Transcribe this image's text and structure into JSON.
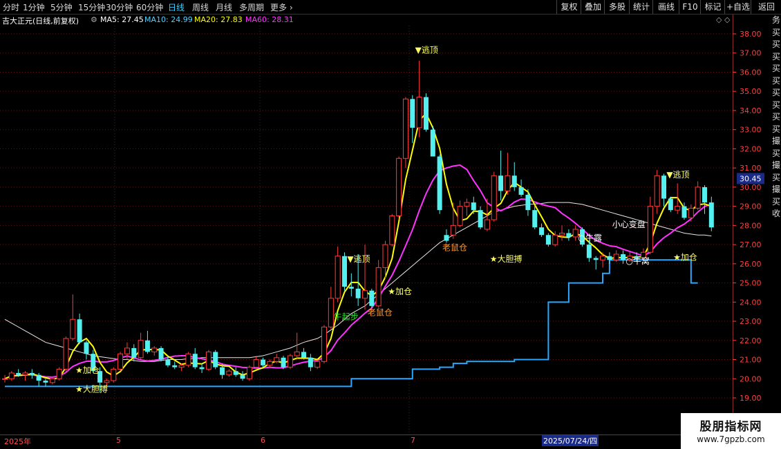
{
  "toolbar": {
    "periods": [
      "分时",
      "1分钟",
      "5分钟",
      "15分钟",
      "30分钟",
      "60分钟",
      "日线",
      "周线",
      "月线",
      "多周期",
      "更多"
    ],
    "active": "日线",
    "right_buttons": [
      "复权",
      "叠加",
      "多股",
      "统计",
      "画线",
      "F10",
      "标记",
      "+自选",
      "返回"
    ]
  },
  "infobar": {
    "stock": "吉大正元(日线,前复权)",
    "ma5": "MA5: 27.45",
    "ma10": "MA10: 24.99",
    "ma20": "MA20: 27.83",
    "ma60": "MA60: 28.31",
    "diamonds": "◇ ◇"
  },
  "colors": {
    "up": "#ff3a3a",
    "down": "#54f0f0",
    "ma5": "#ffff00",
    "ma20": "#ff33ff",
    "ma60": "#e8e8e8",
    "stop": "#29a8ff",
    "axis": "#ff4040",
    "grid": "#5a1a1a"
  },
  "current_price_label": "30.45",
  "bottom_axis": {
    "labels": [
      "2025年",
      "5",
      "6",
      "7"
    ],
    "cursor_date": "2025/07/24/四"
  },
  "watermark": {
    "title": "股朋指标网",
    "url": "www.7gpzb.com"
  },
  "side_strip_text": "务买买买买买买买买买撮买撮买撮买收",
  "chart_data": {
    "type": "candlestick",
    "y_ticks": [
      19.0,
      20.0,
      21.0,
      22.0,
      23.0,
      24.0,
      25.0,
      26.0,
      27.0,
      28.0,
      29.0,
      30.0,
      31.0,
      32.0,
      33.0,
      34.0,
      35.0,
      36.0,
      37.0,
      38.0
    ],
    "ylim": [
      18.4,
      38.6
    ],
    "candles": [
      [
        20.0,
        20.2,
        19.8,
        20.0
      ],
      [
        20.0,
        20.4,
        19.9,
        20.3
      ],
      [
        20.3,
        20.5,
        20.1,
        20.2
      ],
      [
        20.2,
        20.4,
        19.9,
        20.3
      ],
      [
        20.3,
        20.5,
        20.0,
        20.2
      ],
      [
        20.2,
        20.3,
        19.6,
        19.9
      ],
      [
        19.9,
        20.0,
        19.6,
        19.8
      ],
      [
        19.8,
        20.1,
        19.7,
        20.0
      ],
      [
        20.0,
        20.6,
        19.9,
        20.5
      ],
      [
        20.5,
        22.2,
        20.3,
        22.1
      ],
      [
        22.1,
        24.4,
        22.0,
        23.1
      ],
      [
        23.1,
        23.4,
        21.8,
        21.9
      ],
      [
        21.9,
        22.0,
        21.0,
        21.3
      ],
      [
        21.3,
        21.5,
        20.3,
        20.4
      ],
      [
        20.4,
        20.6,
        19.3,
        19.8
      ],
      [
        19.8,
        20.0,
        19.6,
        19.9
      ],
      [
        19.9,
        20.6,
        19.8,
        20.5
      ],
      [
        20.5,
        21.4,
        20.4,
        21.3
      ],
      [
        21.3,
        21.9,
        21.0,
        21.6
      ],
      [
        21.6,
        21.8,
        20.9,
        21.1
      ],
      [
        21.1,
        22.4,
        21.0,
        22.0
      ],
      [
        22.0,
        22.5,
        21.3,
        21.4
      ],
      [
        21.4,
        21.7,
        21.2,
        21.6
      ],
      [
        21.6,
        21.7,
        20.9,
        21.0
      ],
      [
        21.0,
        21.2,
        20.6,
        20.7
      ],
      [
        20.7,
        20.9,
        20.5,
        20.6
      ],
      [
        20.6,
        20.8,
        20.4,
        20.7
      ],
      [
        20.7,
        21.4,
        20.6,
        21.3
      ],
      [
        21.3,
        21.6,
        20.5,
        20.6
      ],
      [
        20.6,
        20.8,
        20.3,
        20.5
      ],
      [
        20.5,
        21.5,
        20.4,
        21.4
      ],
      [
        21.4,
        21.5,
        20.5,
        20.6
      ],
      [
        20.6,
        20.8,
        20.0,
        20.2
      ],
      [
        20.2,
        20.5,
        20.1,
        20.4
      ],
      [
        20.4,
        20.6,
        20.1,
        20.2
      ],
      [
        20.2,
        20.4,
        19.9,
        20.0
      ],
      [
        20.0,
        20.7,
        19.9,
        20.6
      ],
      [
        20.6,
        21.2,
        20.5,
        21.0
      ],
      [
        21.0,
        21.1,
        20.6,
        20.7
      ],
      [
        20.7,
        21.0,
        20.6,
        20.9
      ],
      [
        20.9,
        21.3,
        20.8,
        21.1
      ],
      [
        21.1,
        21.2,
        20.5,
        20.6
      ],
      [
        20.6,
        21.3,
        20.5,
        21.2
      ],
      [
        21.2,
        22.4,
        21.0,
        21.4
      ],
      [
        21.4,
        21.6,
        21.0,
        21.1
      ],
      [
        21.1,
        21.3,
        20.4,
        20.6
      ],
      [
        20.6,
        21.0,
        20.5,
        20.9
      ],
      [
        20.9,
        22.8,
        20.8,
        22.7
      ],
      [
        22.7,
        24.8,
        22.6,
        24.2
      ],
      [
        24.2,
        26.9,
        24.0,
        26.4
      ],
      [
        26.4,
        26.6,
        24.6,
        24.8
      ],
      [
        24.8,
        25.5,
        24.3,
        24.7
      ],
      [
        24.7,
        26.5,
        23.8,
        24.2
      ],
      [
        24.2,
        27.0,
        23.6,
        24.6
      ],
      [
        24.6,
        24.7,
        23.7,
        23.8
      ],
      [
        23.8,
        26.2,
        23.7,
        25.8
      ],
      [
        25.8,
        27.2,
        25.2,
        27.0
      ],
      [
        27.0,
        28.6,
        26.9,
        28.5
      ],
      [
        28.5,
        31.6,
        28.3,
        31.5
      ],
      [
        31.5,
        34.7,
        31.0,
        34.6
      ],
      [
        34.6,
        34.8,
        32.3,
        33.1
      ],
      [
        33.1,
        36.6,
        32.6,
        34.7
      ],
      [
        34.7,
        34.9,
        32.9,
        33.0
      ],
      [
        33.0,
        33.2,
        31.8,
        31.6
      ],
      [
        31.6,
        31.7,
        28.6,
        28.8
      ],
      [
        27.5,
        27.8,
        27.1,
        27.2
      ],
      [
        27.5,
        29.2,
        27.3,
        28.0
      ],
      [
        28.0,
        29.3,
        27.9,
        29.0
      ],
      [
        29.0,
        29.4,
        28.5,
        29.2
      ],
      [
        29.2,
        29.5,
        28.6,
        28.8
      ],
      [
        28.8,
        29.0,
        27.8,
        27.9
      ],
      [
        27.8,
        29.4,
        27.7,
        28.3
      ],
      [
        28.3,
        30.8,
        28.2,
        30.6
      ],
      [
        30.6,
        31.9,
        29.3,
        29.8
      ],
      [
        29.8,
        31.8,
        29.6,
        30.6
      ],
      [
        30.6,
        31.3,
        29.8,
        30.0
      ],
      [
        30.0,
        30.4,
        29.5,
        29.6
      ],
      [
        29.6,
        29.9,
        28.5,
        28.8
      ],
      [
        28.8,
        29.0,
        27.8,
        27.9
      ],
      [
        27.9,
        28.1,
        27.4,
        27.5
      ],
      [
        27.5,
        27.6,
        26.9,
        27.0
      ],
      [
        27.0,
        27.7,
        26.9,
        27.5
      ],
      [
        27.5,
        28.0,
        27.2,
        27.6
      ],
      [
        27.6,
        27.8,
        27.2,
        27.4
      ],
      [
        27.4,
        28.0,
        27.2,
        27.8
      ],
      [
        27.8,
        27.9,
        26.9,
        27.0
      ],
      [
        27.0,
        27.2,
        26.1,
        26.3
      ],
      [
        26.3,
        26.4,
        25.7,
        26.2
      ],
      [
        26.2,
        26.6,
        25.8,
        26.4
      ],
      [
        26.4,
        26.6,
        26.0,
        26.2
      ],
      [
        26.2,
        26.7,
        26.1,
        26.5
      ],
      [
        26.5,
        26.7,
        26.0,
        26.2
      ],
      [
        26.2,
        26.6,
        26.1,
        26.4
      ],
      [
        26.4,
        26.6,
        26.1,
        26.3
      ],
      [
        26.3,
        26.8,
        26.2,
        26.6
      ],
      [
        26.6,
        29.5,
        26.5,
        29.0
      ],
      [
        29.0,
        30.9,
        28.6,
        30.6
      ],
      [
        30.6,
        30.7,
        29.0,
        29.4
      ],
      [
        29.4,
        29.5,
        28.7,
        28.8
      ],
      [
        28.8,
        30.2,
        28.6,
        29.0
      ],
      [
        29.0,
        29.2,
        28.3,
        28.4
      ],
      [
        28.4,
        29.1,
        28.2,
        28.9
      ],
      [
        28.9,
        30.3,
        28.8,
        30.0
      ],
      [
        30.0,
        30.1,
        28.6,
        29.2
      ],
      [
        29.2,
        29.5,
        27.7,
        27.9
      ]
    ],
    "ma60_values": [
      23.1,
      22.9,
      22.7,
      22.5,
      22.3,
      22.1,
      21.9,
      21.8,
      21.7,
      21.6,
      21.5,
      21.4,
      21.3,
      21.2,
      21.15,
      21.1,
      21.05,
      21.0,
      21.0,
      20.95,
      20.9,
      20.9,
      20.9,
      20.95,
      21.0,
      21.0,
      21.0,
      21.05,
      21.05,
      21.1,
      21.1,
      21.1,
      21.1,
      21.1,
      21.1,
      21.1,
      21.1,
      21.15,
      21.2,
      21.3,
      21.4,
      21.5,
      21.6,
      21.75,
      21.9,
      22.0,
      22.1,
      22.3,
      22.55,
      22.8,
      23.1,
      23.4,
      23.6,
      23.8,
      24.1,
      24.4,
      24.7,
      25.0,
      25.3,
      25.6,
      25.9,
      26.2,
      26.5,
      26.8,
      27.1,
      27.3,
      27.5,
      27.7,
      27.9,
      28.1,
      28.3,
      28.5,
      28.7,
      28.8,
      28.9,
      29.0,
      29.05,
      29.1,
      29.12,
      29.15,
      29.2,
      29.2,
      29.2,
      29.2,
      29.15,
      29.1,
      29.0,
      28.9,
      28.8,
      28.7,
      28.6,
      28.5,
      28.4,
      28.3,
      28.2,
      28.1,
      28.0,
      27.9,
      27.8,
      27.7,
      27.6,
      27.55,
      27.5,
      27.5,
      27.45
    ],
    "stop_line": [
      [
        0,
        19.6
      ],
      [
        47,
        19.6
      ],
      [
        51,
        20.0
      ],
      [
        56,
        20.0
      ],
      [
        60,
        20.5
      ],
      [
        63,
        20.5
      ],
      [
        64,
        20.6
      ],
      [
        66,
        20.8
      ],
      [
        68,
        20.9
      ],
      [
        73,
        20.9
      ],
      [
        75,
        21.0
      ],
      [
        77,
        21.0
      ],
      [
        80,
        21.0
      ],
      [
        80,
        24.0
      ],
      [
        83,
        25.0
      ],
      [
        87,
        25.0
      ],
      [
        88,
        25.5
      ],
      [
        89,
        26.2
      ],
      [
        101,
        26.2
      ],
      [
        101,
        25.0
      ],
      [
        102,
        25.0
      ]
    ],
    "stop_line_style": "step",
    "annotations": [
      {
        "text": "▼逃顶",
        "x": 61,
        "y": 37.0,
        "color": "#ffff66"
      },
      {
        "text": "▼逃顶",
        "x": 51,
        "y": 26.1,
        "color": "#ffff66"
      },
      {
        "text": "▼逃顶",
        "x": 98,
        "y": 30.5,
        "color": "#ffff66"
      },
      {
        "text": "★加仓",
        "x": 11,
        "y": 20.3,
        "color": "#ffff66"
      },
      {
        "text": "★加仓",
        "x": 57,
        "y": 24.4,
        "color": "#ffff66"
      },
      {
        "text": "★加仓",
        "x": 99,
        "y": 26.2,
        "color": "#ffff66"
      },
      {
        "text": "★大胆搏",
        "x": 11,
        "y": 19.3,
        "color": "#ffff66"
      },
      {
        "text": "★大胆搏",
        "x": 72,
        "y": 26.1,
        "color": "#ffff66"
      },
      {
        "text": "牛起步",
        "x": 49,
        "y": 23.1,
        "color": "#33dd33"
      },
      {
        "text": "老鼠仓",
        "x": 54,
        "y": 23.3,
        "color": "#ff9933"
      },
      {
        "text": "老鼠仓",
        "x": 65,
        "y": 26.7,
        "color": "#ff9933"
      },
      {
        "text": "○牛露",
        "x": 85,
        "y": 27.2,
        "color": "#ffffff"
      },
      {
        "text": "○牛窝",
        "x": 92,
        "y": 26.0,
        "color": "#ffffff"
      },
      {
        "text": "小心变盘",
        "x": 90,
        "y": 27.9,
        "color": "#ffffff"
      }
    ],
    "title": "",
    "xlabel": "",
    "ylabel": ""
  }
}
